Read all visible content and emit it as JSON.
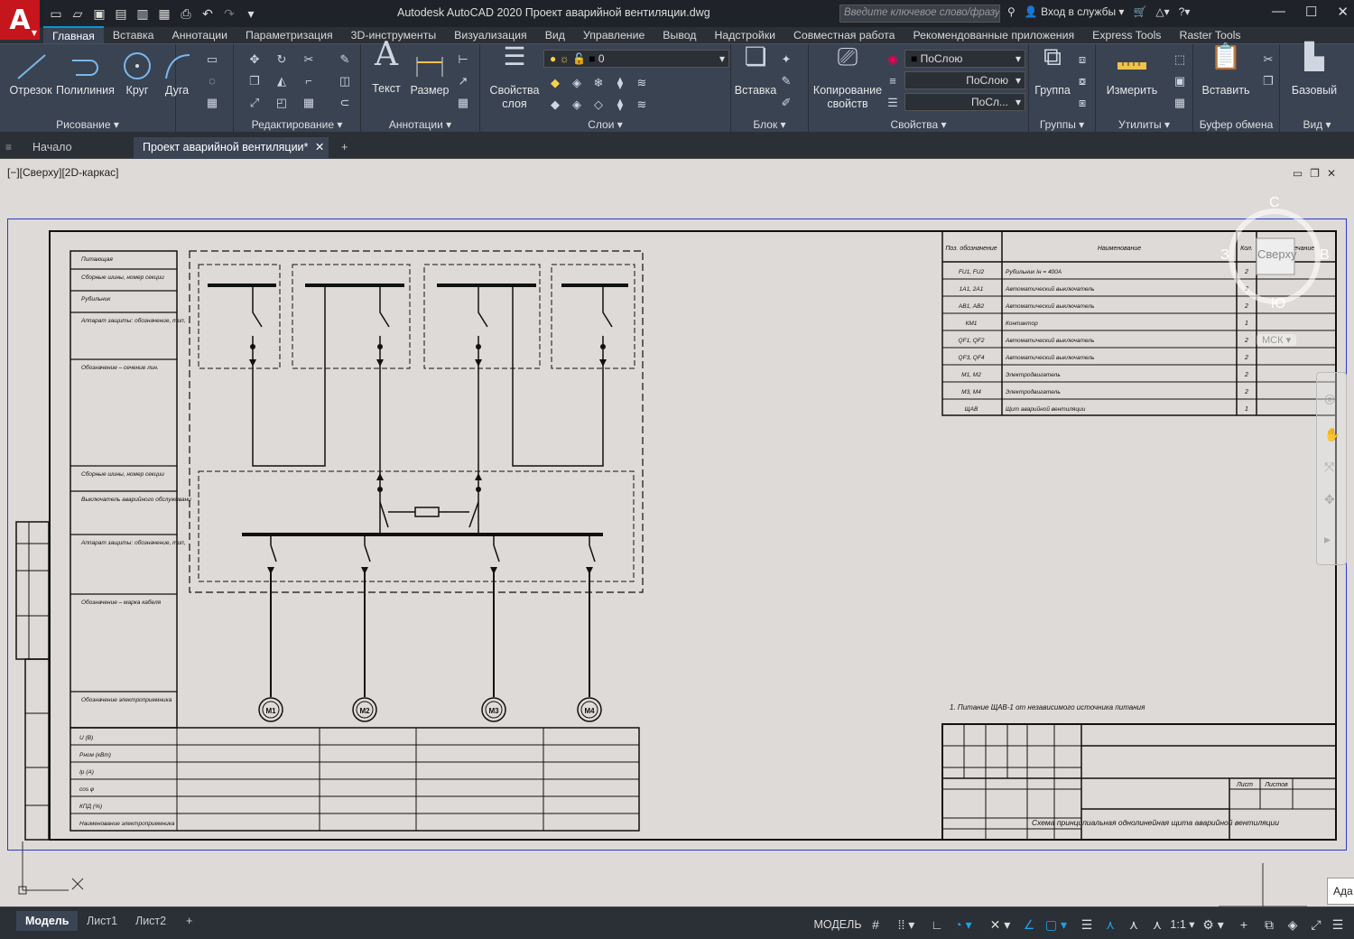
{
  "app": {
    "logo": "A",
    "title": "Autodesk AutoCAD 2020   Проект аварийной вентиляции.dwg"
  },
  "search": {
    "placeholder": "Введите ключевое слово/фразу"
  },
  "signin": "Вход в службы",
  "menu_tabs": [
    "Главная",
    "Вставка",
    "Аннотации",
    "Параметризация",
    "3D-инструменты",
    "Визуализация",
    "Вид",
    "Управление",
    "Вывод",
    "Надстройки",
    "Совместная работа",
    "Рекомендованные приложения",
    "Express Tools",
    "Raster Tools"
  ],
  "ribbon": {
    "draw": {
      "line": "Отрезок",
      "polyline": "Полилиния",
      "circle": "Круг",
      "arc": "Дуга",
      "label": "Рисование ▾"
    },
    "modify": {
      "label": "Редактирование ▾"
    },
    "annotation": {
      "text": "Текст",
      "dimension": "Размер",
      "label": "Аннотации ▾"
    },
    "layers": {
      "props_1": "Свойства",
      "props_2": "слоя",
      "current_layer": "0",
      "label": "Слои ▾"
    },
    "block": {
      "insert": "Вставка",
      "label": "Блок ▾"
    },
    "properties": {
      "match_1": "Копирование",
      "match_2": "свойств",
      "color": "ПоСлою",
      "linetype": "ПоСлою",
      "lineweight": "ПоСл...",
      "label": "Свойства ▾"
    },
    "groups": {
      "group": "Группа",
      "label": "Группы ▾"
    },
    "utilities": {
      "measure": "Измерить",
      "label": "Утилиты ▾"
    },
    "clipboard": {
      "paste": "Вставить",
      "label": "Буфер обмена"
    },
    "view": {
      "base": "Базовый",
      "label": "Вид ▾"
    }
  },
  "doc_tabs": {
    "start": "Начало",
    "active": "Проект аварийной вентиляции*",
    "close": "✕",
    "add": "+"
  },
  "viewport": {
    "label": "[−][Сверху][2D-каркас]"
  },
  "viewcube": {
    "north": "С",
    "south": "Ю",
    "east": "В",
    "west": "З",
    "face": "Сверху",
    "ucs": "МСК"
  },
  "tooltip": "Ада",
  "layout_tabs": {
    "model": "Модель",
    "sheet1": "Лист1",
    "sheet2": "Лист2",
    "add": "+"
  },
  "status": {
    "model": "МОДЕЛЬ",
    "scale": "1:1"
  },
  "drawing": {
    "left_rows": [
      "Питающая",
      "Сборные шины, номер секции",
      "Рубильник",
      "Аппарат защиты: обозначение, тип, Iном (А), Iтр (кА)",
      "Обозначение – сечение лин.",
      "Сборные шины, номер секции",
      "Выключатель аварийного обслуживания",
      "Аппарат защиты: обозначение, тип, Iном (А), Iуст. (А)",
      "Обозначение – марка кабеля",
      "Обозначение электроприемника"
    ],
    "bottom_rows": [
      "U (В)",
      "Pном (кВт)",
      "Iр (А)",
      "cos φ",
      "КПД (%)",
      "Наименование электроприемника"
    ],
    "consumers": [
      "М1",
      "М2",
      "М3",
      "М4"
    ],
    "spec_headers": [
      "Поз. обозначение",
      "Наименование",
      "Кол.",
      "Примечание"
    ],
    "spec_rows": [
      [
        "FU1, FU2",
        "Рубильник Iн = 400А",
        "2"
      ],
      [
        "1А1, 2А1",
        "Автоматический выключатель",
        "2"
      ],
      [
        "АВ1, АВ2",
        "Автоматический выключатель",
        "2"
      ],
      [
        "КМ1",
        "Контактор",
        "1"
      ],
      [
        "QF1, QF2",
        "Автоматический выключатель",
        "2"
      ],
      [
        "QF3, QF4",
        "Автоматический выключатель",
        "2"
      ],
      [
        "М1, М2",
        "Электродвигатель",
        "2"
      ],
      [
        "М3, М4",
        "Электродвигатель",
        "2"
      ],
      [
        "ЩАВ",
        "Щит аварийной вентиляции",
        "1"
      ]
    ],
    "note": "1. Питание ЩАВ-1 от независимого источника питания",
    "stamp_title": "Схема принципиальная однолинейная щита аварийной вентиляции",
    "stamp_sheet": "Лист",
    "stamp_sheets": "Листов"
  }
}
